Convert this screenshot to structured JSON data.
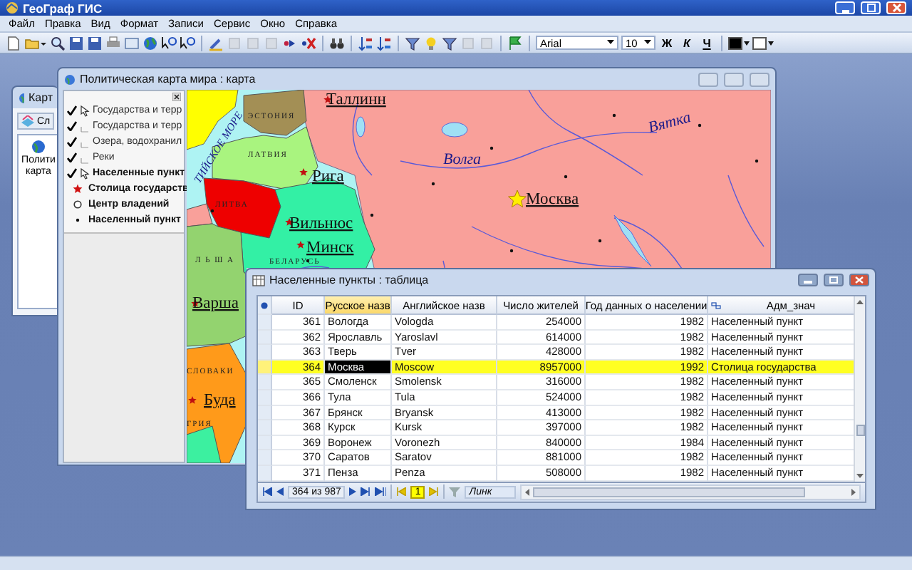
{
  "app": {
    "title": "ГеоГраф ГИС",
    "menu": [
      "Файл",
      "Правка",
      "Вид",
      "Формат",
      "Записи",
      "Сервис",
      "Окно",
      "Справка"
    ],
    "font": "Arial",
    "font_size": "10",
    "format_buttons": [
      "Ж",
      "К",
      "Ч"
    ]
  },
  "back_window": {
    "title": "Карт",
    "button": "Сл",
    "item_lines": [
      "Полити",
      "карта"
    ]
  },
  "map_window": {
    "title": "Политическая карта мира : карта",
    "layers": [
      {
        "label": "Государства и терр",
        "checked": true,
        "active": true,
        "bold": false
      },
      {
        "label": "Государства и терр",
        "checked": true,
        "active": false,
        "bold": false
      },
      {
        "label": "Озера, водохранил",
        "checked": true,
        "active": false,
        "bold": false
      },
      {
        "label": "Реки",
        "checked": true,
        "active": false,
        "bold": false
      },
      {
        "label": "Населенные пункт",
        "checked": true,
        "active": true,
        "bold": true
      }
    ],
    "symbols": [
      {
        "label": "Столица государств",
        "kind": "star"
      },
      {
        "label": "Центр владений",
        "kind": "circle"
      },
      {
        "label": "Населенный пункт",
        "kind": "dot"
      }
    ],
    "labels": [
      {
        "text": "ТИЙСКОЕ МОРЕ",
        "kind": "sea"
      },
      {
        "text": "Таллинн",
        "kind": "city"
      },
      {
        "text": "ЭСТОНИЯ",
        "kind": "country"
      },
      {
        "text": "ЛАТВИЯ",
        "kind": "country"
      },
      {
        "text": "Рига",
        "kind": "city"
      },
      {
        "text": "ЛИТВА",
        "kind": "country"
      },
      {
        "text": "Вильнюс",
        "kind": "city"
      },
      {
        "text": "Минск",
        "kind": "city"
      },
      {
        "text": "БЕЛАРУСЬ",
        "kind": "country"
      },
      {
        "text": "Л Ь Ш А",
        "kind": "country"
      },
      {
        "text": "Варша",
        "kind": "city"
      },
      {
        "text": "Волга",
        "kind": "river"
      },
      {
        "text": "Москва",
        "kind": "city"
      },
      {
        "text": "Вятка",
        "kind": "river"
      },
      {
        "text": "СЛОВАКИ",
        "kind": "country"
      },
      {
        "text": "Буда",
        "kind": "city"
      },
      {
        "text": "ГРИЯ",
        "kind": "country"
      }
    ]
  },
  "table_window": {
    "title": "Населенные пункты : таблица",
    "columns": [
      {
        "label": "ID",
        "selected": false
      },
      {
        "label": "Русское назв",
        "selected": true
      },
      {
        "label": "Английское назв",
        "selected": false
      },
      {
        "label": "Число жителей",
        "selected": false
      },
      {
        "label": "Год данных о населении",
        "selected": false
      },
      {
        "label": "Адм_знач",
        "selected": false
      }
    ],
    "rows": [
      {
        "id": "361",
        "ru": "Вологда",
        "en": "Vologda",
        "population": "254000",
        "year": "1982",
        "adm": "Населенный пункт",
        "selected": false
      },
      {
        "id": "362",
        "ru": "Ярославль",
        "en": "Yaroslavl",
        "population": "614000",
        "year": "1982",
        "adm": "Населенный пункт",
        "selected": false
      },
      {
        "id": "363",
        "ru": "Тверь",
        "en": "Tver",
        "population": "428000",
        "year": "1982",
        "adm": "Населенный пункт",
        "selected": false
      },
      {
        "id": "364",
        "ru": "Москва",
        "en": "Moscow",
        "population": "8957000",
        "year": "1992",
        "adm": "Столица государства",
        "selected": true
      },
      {
        "id": "365",
        "ru": "Смоленск",
        "en": "Smolensk",
        "population": "316000",
        "year": "1982",
        "adm": "Населенный пункт",
        "selected": false
      },
      {
        "id": "366",
        "ru": "Тула",
        "en": "Tula",
        "population": "524000",
        "year": "1982",
        "adm": "Населенный пункт",
        "selected": false
      },
      {
        "id": "367",
        "ru": "Брянск",
        "en": "Bryansk",
        "population": "413000",
        "year": "1982",
        "adm": "Населенный пункт",
        "selected": false
      },
      {
        "id": "368",
        "ru": "Курск",
        "en": "Kursk",
        "population": "397000",
        "year": "1982",
        "adm": "Населенный пункт",
        "selected": false
      },
      {
        "id": "369",
        "ru": "Воронеж",
        "en": "Voronezh",
        "population": "840000",
        "year": "1984",
        "adm": "Населенный пункт",
        "selected": false
      },
      {
        "id": "370",
        "ru": "Саратов",
        "en": "Saratov",
        "population": "881000",
        "year": "1982",
        "adm": "Населенный пункт",
        "selected": false
      },
      {
        "id": "371",
        "ru": "Пенза",
        "en": "Penza",
        "population": "508000",
        "year": "1982",
        "adm": "Населенный пункт",
        "selected": false
      }
    ],
    "nav": {
      "record": "364 из 987",
      "page": "1",
      "filter": "Линк"
    }
  }
}
